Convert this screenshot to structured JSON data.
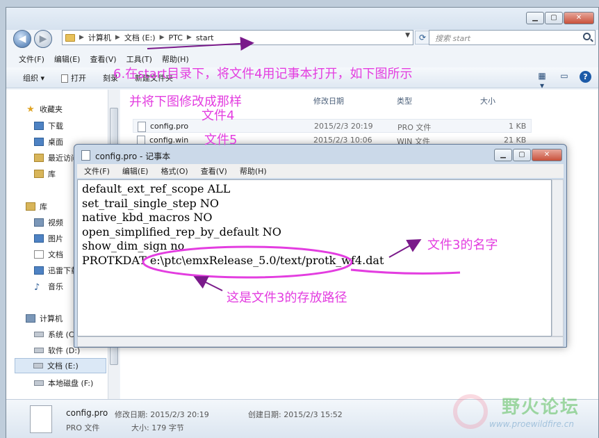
{
  "explorer": {
    "breadcrumb": [
      "计算机",
      "文档 (E:)",
      "PTC",
      "start"
    ],
    "search_placeholder": "搜索 start",
    "menu": [
      "文件(F)",
      "编辑(E)",
      "查看(V)",
      "工具(T)",
      "帮助(H)"
    ],
    "toolbar": [
      "组织 ▾",
      "打开",
      "刻录",
      "新建文件夹"
    ],
    "nav": [
      {
        "label": "收藏夹",
        "icon": "star-icon",
        "level": "head"
      },
      {
        "label": "下载",
        "icon": "download-folder-icon",
        "level": "sub"
      },
      {
        "label": "桌面",
        "icon": "desktop-icon",
        "level": "sub"
      },
      {
        "label": "最近访问",
        "icon": "recent-places-icon",
        "level": "sub"
      },
      {
        "label": "库",
        "icon": "library-icon",
        "level": "sub"
      },
      {
        "label": "库",
        "icon": "library-icon",
        "level": "head"
      },
      {
        "label": "视频",
        "icon": "video-icon",
        "level": "sub"
      },
      {
        "label": "图片",
        "icon": "pictures-icon",
        "level": "sub"
      },
      {
        "label": "文档",
        "icon": "documents-icon",
        "level": "sub"
      },
      {
        "label": "迅雷下载",
        "icon": "thunder-icon",
        "level": "sub"
      },
      {
        "label": "音乐",
        "icon": "music-icon",
        "level": "sub"
      },
      {
        "label": "计算机",
        "icon": "computer-icon",
        "level": "head"
      },
      {
        "label": "系统 (C:)",
        "icon": "drive-icon",
        "level": "sub"
      },
      {
        "label": "软件 (D:)",
        "icon": "drive-icon",
        "level": "sub"
      },
      {
        "label": "文档 (E:)",
        "icon": "drive-icon",
        "level": "selected"
      },
      {
        "label": "本地磁盘 (F:)",
        "icon": "drive-icon",
        "level": "sub"
      }
    ],
    "columns": {
      "date": "修改日期",
      "type": "类型",
      "size": "大小"
    },
    "files": [
      {
        "name": "config.pro",
        "date": "2015/2/3 20:19",
        "type": "PRO 文件",
        "size": "1 KB"
      },
      {
        "name": "config.win",
        "date": "2015/2/3 10:06",
        "type": "WIN 文件",
        "size": "21 KB"
      }
    ],
    "details": {
      "name": "config.pro",
      "type": "PRO 文件",
      "modified_label": "修改日期: 2015/2/3 20:19",
      "created_label": "创建日期: 2015/2/3 15:52",
      "size_label": "大小: 179 字节"
    }
  },
  "notepad": {
    "title": "config.pro - 记事本",
    "menu": [
      "文件(F)",
      "编辑(E)",
      "格式(O)",
      "查看(V)",
      "帮助(H)"
    ],
    "lines": [
      "default_ext_ref_scope ALL",
      "set_trail_single_step NO",
      "native_kbd_macros NO",
      "open_simplified_rep_by_default NO",
      "show_dim_sign no",
      "PROTKDAT e:\\ptc\\emxRelease_5.0/text/protk_wf4.dat"
    ]
  },
  "annotations": {
    "step_line1": "6.在start目录下，将文件4用记事本打开，如下图所示",
    "step_line2": "并将下图修改成那样",
    "file4": "文件4",
    "file5": "文件5",
    "file3_name": "文件3的名字",
    "file3_path": "这是文件3的存放路径",
    "color": "#e33de0"
  },
  "watermark": {
    "text": "野火论坛",
    "url": "www.proewildfire.cn"
  }
}
